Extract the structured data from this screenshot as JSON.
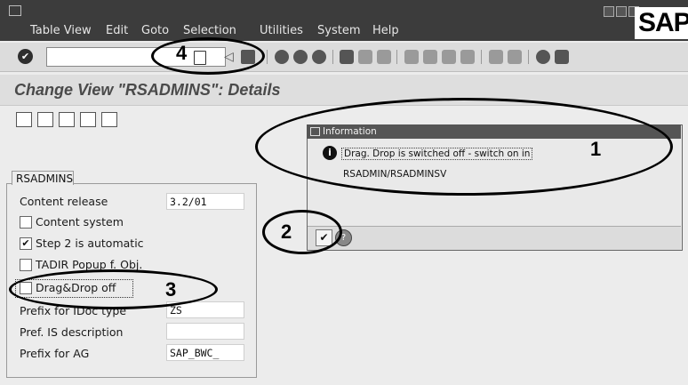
{
  "menubar": {
    "items": [
      "Table View",
      "Edit",
      "Goto",
      "Selection",
      "Utilities",
      "System",
      "Help"
    ]
  },
  "logo": "SAP",
  "toolbar": {
    "enter_icon": "check-icon",
    "command_value": "",
    "save_icon": "save-icon",
    "back_icon": "back-icon",
    "exit_icon": "exit-icon",
    "cancel_icon": "cancel-icon",
    "print_icon": "print-icon",
    "find_icon": "find-icon",
    "help_icon": "help-icon"
  },
  "title": "Change View \"RSADMINS\": Details",
  "group": {
    "tab_label": "RSADMINS",
    "content_release_label": "Content release",
    "content_release_value": "3.2/01",
    "content_system_label": "Content system",
    "content_system_checked": false,
    "step2_label": "Step 2 is automatic",
    "step2_checked": true,
    "tadir_label": "TADIR Popup f. Obj.",
    "tadir_checked": false,
    "dragdrop_label": "Drag&Drop off",
    "dragdrop_checked": false,
    "prefix_idoc_label": "Prefix for IDoc type",
    "prefix_idoc_value": "ZS",
    "pref_is_label": "Pref. IS description",
    "pref_is_value": "",
    "prefix_ag_label": "Prefix for AG",
    "prefix_ag_value": "SAP_BWC_"
  },
  "popup": {
    "title": "Information",
    "message_line1": "Drag. Drop is switched off - switch on in",
    "message_line2": "RSADMIN/RSADMINSV",
    "ok_glyph": "✔",
    "help_glyph": "?"
  },
  "annotations": [
    "1",
    "2",
    "3",
    "4"
  ]
}
